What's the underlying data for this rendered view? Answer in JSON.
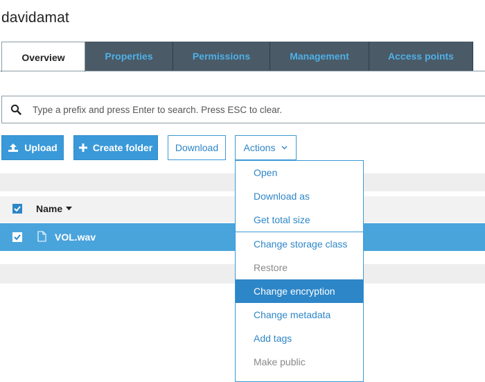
{
  "page": {
    "title": "davidamat"
  },
  "tabs": [
    {
      "label": "Overview",
      "active": true
    },
    {
      "label": "Properties"
    },
    {
      "label": "Permissions"
    },
    {
      "label": "Management"
    },
    {
      "label": "Access points"
    }
  ],
  "search": {
    "placeholder": "Type a prefix and press Enter to search. Press ESC to clear.",
    "value": ""
  },
  "toolbar": {
    "upload_label": "Upload",
    "create_folder_label": "Create folder",
    "download_label": "Download",
    "actions_label": "Actions"
  },
  "table": {
    "header": {
      "name_label": "Name",
      "sort": "descending",
      "select_all_checked": true
    },
    "rows": [
      {
        "name": "VOL.wav",
        "checked": true,
        "icon": "file-icon"
      }
    ]
  },
  "actions_menu": {
    "items": [
      {
        "label": "Open",
        "state": "enabled"
      },
      {
        "label": "Download as",
        "state": "enabled"
      },
      {
        "label": "Get total size",
        "state": "enabled"
      },
      {
        "label": "Change storage class",
        "state": "enabled"
      },
      {
        "label": "Restore",
        "state": "disabled"
      },
      {
        "label": "Change encryption",
        "state": "highlighted"
      },
      {
        "label": "Change metadata",
        "state": "enabled"
      },
      {
        "label": "Add tags",
        "state": "enabled"
      },
      {
        "label": "Make public",
        "state": "disabled"
      }
    ]
  },
  "colors": {
    "accent": "#3a99d8",
    "tab_bg": "#4a5a66",
    "tab_text": "#4fb0e8",
    "selected_row": "#4aa4dc"
  }
}
